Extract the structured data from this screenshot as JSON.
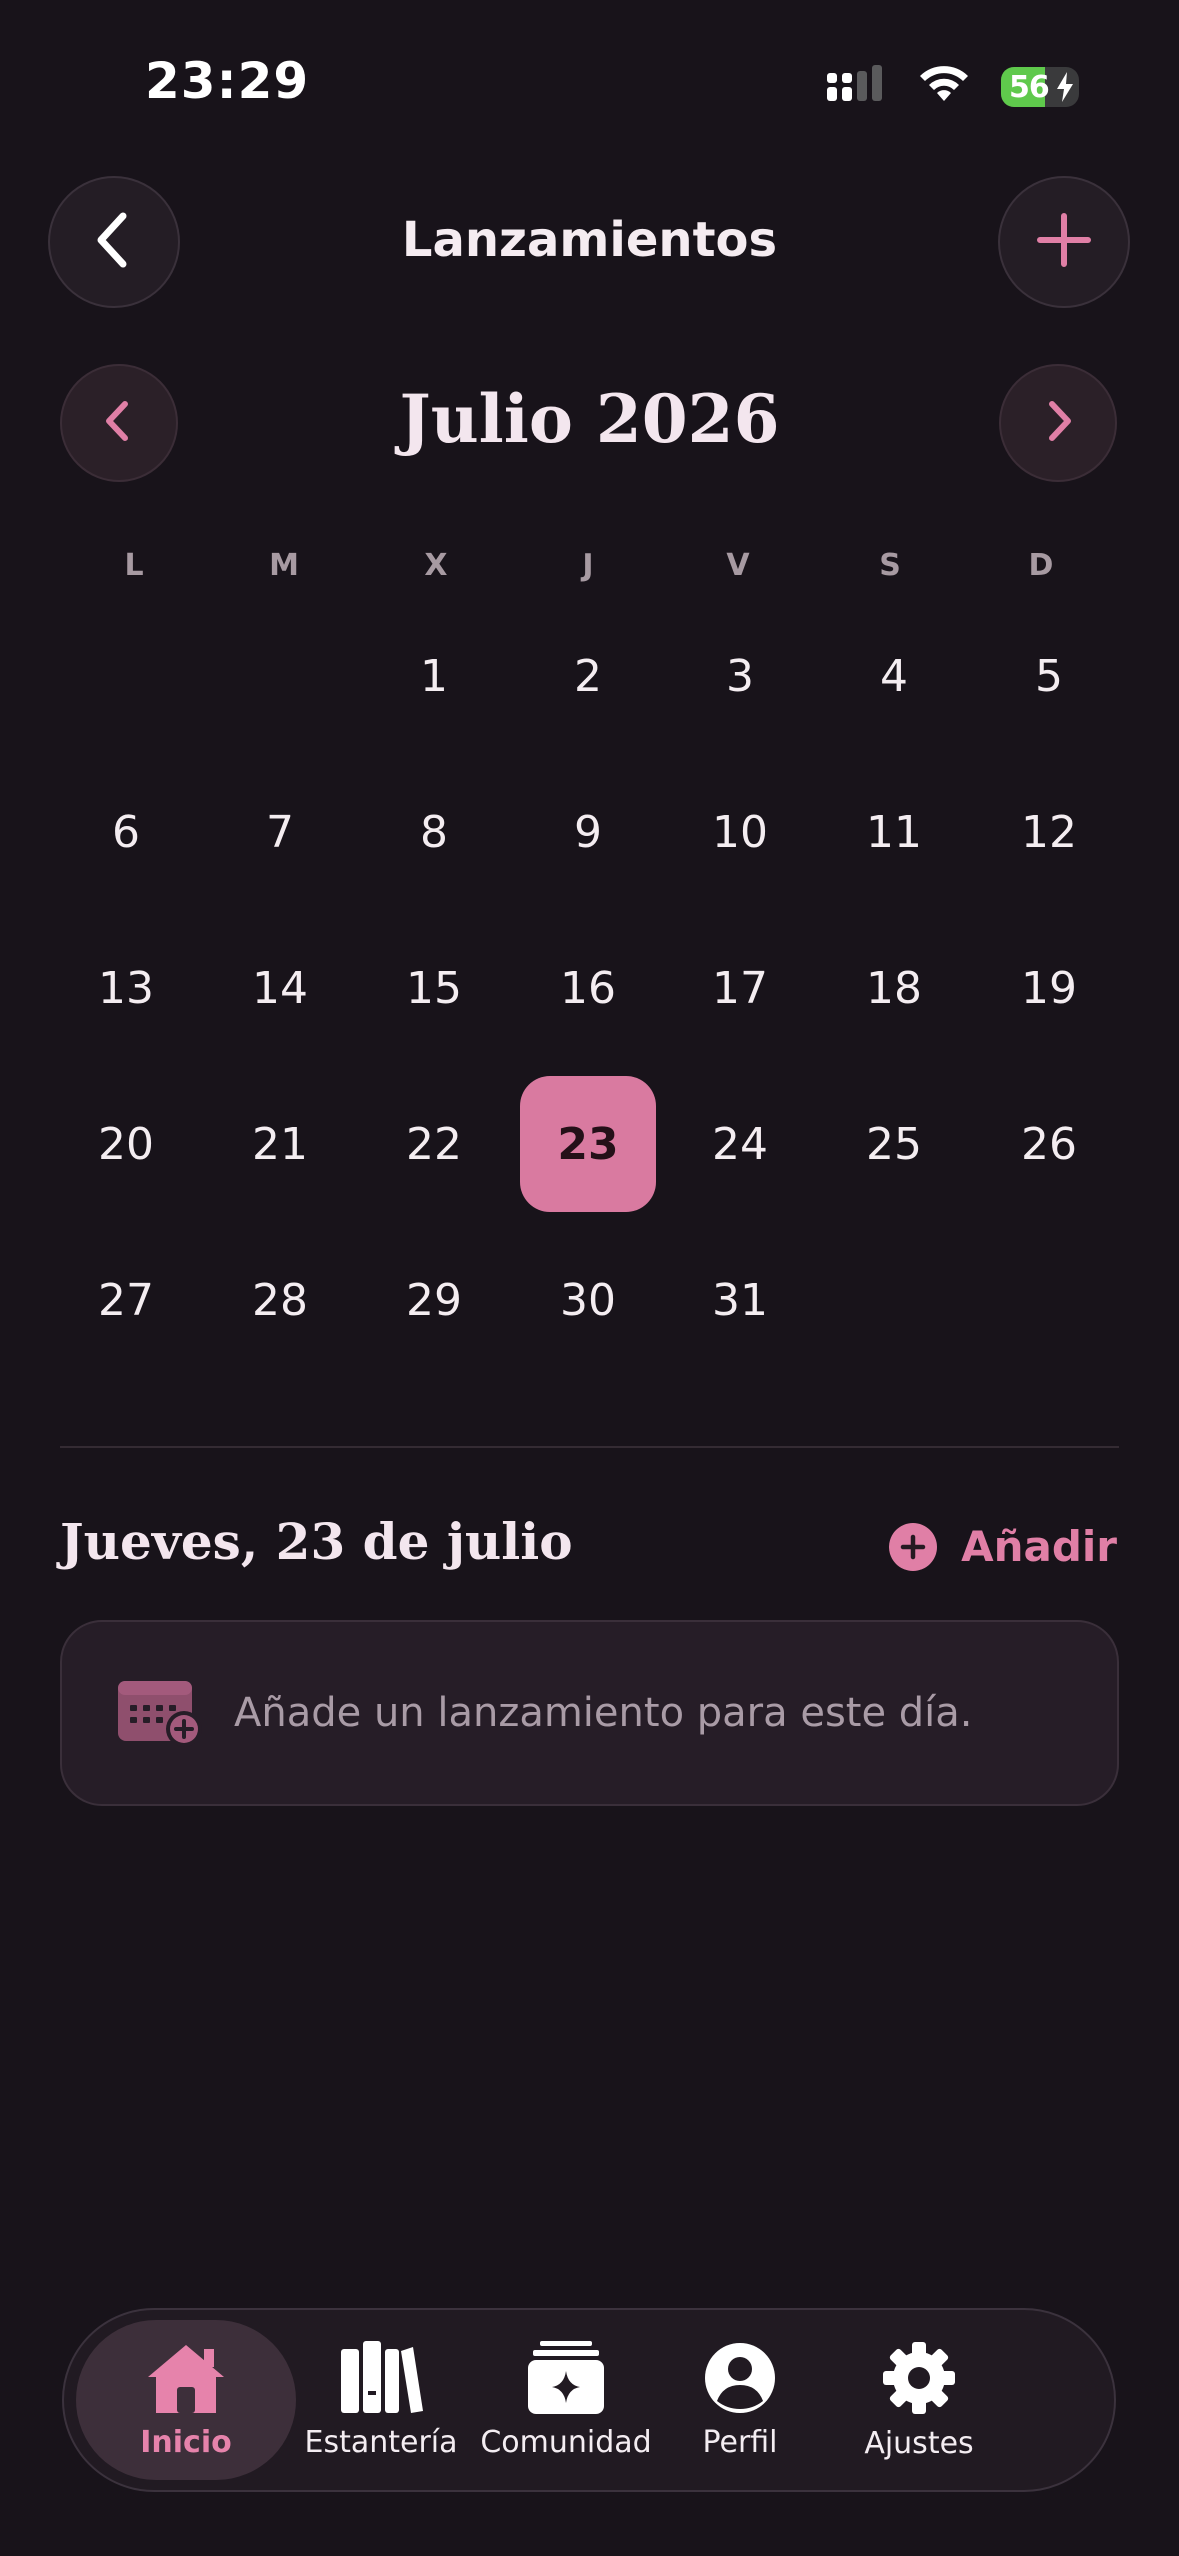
{
  "status_bar": {
    "time": "23:29",
    "battery_level": "56",
    "battery_fraction": 0.56
  },
  "header": {
    "title": "Lanzamientos",
    "back_icon": "chevron-left-icon",
    "add_icon": "plus-icon"
  },
  "calendar": {
    "month_title": "Julio 2026",
    "weekdays": [
      "L",
      "M",
      "X",
      "J",
      "V",
      "S",
      "D"
    ],
    "days": [
      "1",
      "2",
      "3",
      "4",
      "5",
      "6",
      "7",
      "8",
      "9",
      "10",
      "11",
      "12",
      "13",
      "14",
      "15",
      "16",
      "17",
      "18",
      "19",
      "20",
      "21",
      "22",
      "23",
      "24",
      "25",
      "26",
      "27",
      "28",
      "29",
      "30",
      "31"
    ],
    "selected_day": "23",
    "first_weekday_index": 2
  },
  "day_section": {
    "heading": "Jueves, 23 de julio",
    "add_label": "Añadir",
    "empty_text": "Añade un lanzamiento para este día."
  },
  "tabbar": {
    "tabs": [
      {
        "label": "Inicio",
        "icon": "home-icon",
        "active": true
      },
      {
        "label": "Estantería",
        "icon": "books-icon",
        "active": false
      },
      {
        "label": "Comunidad",
        "icon": "community-icon",
        "active": false
      },
      {
        "label": "Perfil",
        "icon": "person-icon",
        "active": false
      },
      {
        "label": "Ajustes",
        "icon": "gear-icon",
        "active": false
      }
    ]
  },
  "colors": {
    "background": "#18131a",
    "accent": "#e07fa6",
    "selected_day": "#d97aa0"
  }
}
